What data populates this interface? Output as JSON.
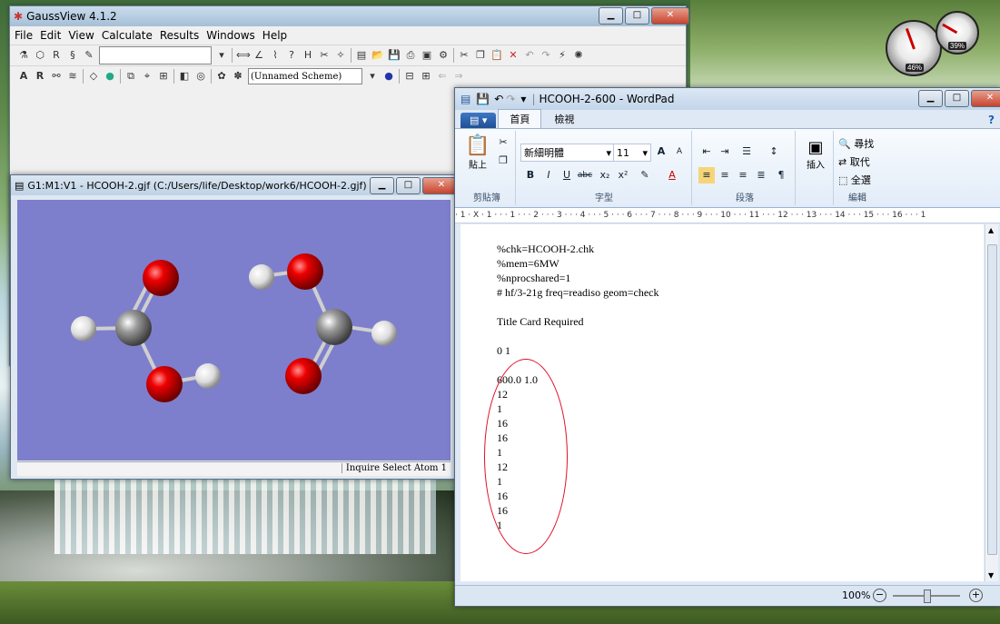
{
  "desktop": {
    "gauges": [
      {
        "name": "cpu",
        "percent": 46
      },
      {
        "name": "memory",
        "percent": 39
      }
    ]
  },
  "gaussview": {
    "title": "GaussView 4.1.2",
    "menu": [
      "File",
      "Edit",
      "View",
      "Calculate",
      "Results",
      "Windows",
      "Help"
    ],
    "scheme": "(Unnamed Scheme)"
  },
  "molecule_window": {
    "title": "G1:M1:V1 - HCOOH-2.gjf (C:/Users/life/Desktop/work6/HCOOH-2.gjf)",
    "status": "Inquire  Select Atom 1",
    "background_color": "#7d7fcc"
  },
  "wordpad": {
    "title": "HCOOH-2-600 - WordPad",
    "tabs": [
      "首頁",
      "檢視"
    ],
    "font_name": "新細明體",
    "font_size": "11",
    "groups": {
      "clipboard": "剪貼簿",
      "font": "字型",
      "paragraph": "段落",
      "insert": "插入",
      "editing": "編輯"
    },
    "paste_label": "貼上",
    "find": "尋找",
    "replace": "取代",
    "select_all": "全選",
    "ruler": "· 1 · X · 1 · · · 1 · · · 2 · · · 3 · · · 4 · · · 5 · · · 6 · · · 7 · · · 8 · · · 9 · · · 10 · · · 11 · · · 12 · · · 13 · · · 14 · · · 15 · · · 16 · · · 1",
    "zoom": "100%",
    "document_lines": [
      "%chk=HCOOH-2.chk",
      "%mem=6MW",
      "%nprocshared=1",
      "# hf/3-21g freq=readiso geom=check",
      "",
      "Title Card Required",
      "",
      "0 1",
      "",
      "600.0 1.0",
      "12",
      "1",
      "16",
      "16",
      "1",
      "12",
      "1",
      "16",
      "16",
      "1"
    ]
  }
}
